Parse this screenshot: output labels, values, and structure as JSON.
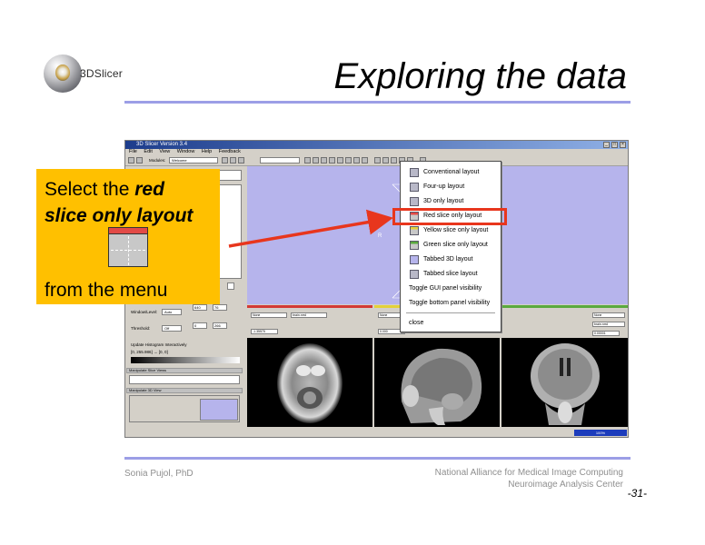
{
  "slide": {
    "title": "Exploring the data",
    "logo_text": "3DSlicer",
    "footer_left": "Sonia Pujol, PhD",
    "footer_right_line1": "National Alliance for Medical Image Computing",
    "footer_right_line2": "Neuroimage Analysis Center",
    "page_number": "-31-"
  },
  "callout": {
    "line1_plain": "Select the ",
    "line1_bold": "red",
    "line2_bold": "slice only layout",
    "footer": "from the menu"
  },
  "app": {
    "window_title": "3D Slicer Version 3.4",
    "menus": [
      "File",
      "Edit",
      "View",
      "Window",
      "Help",
      "Feedback"
    ],
    "toolbar_modules_label": "Modules:",
    "toolbar_module_value": "Welcome",
    "left_panel": {
      "window_level_label": "Window/Level:",
      "window_level_mode": "Auto",
      "window_value": "640",
      "level_value": "76",
      "threshold_label": "Threshold:",
      "threshold_mode": "Off",
      "threshold_min": "0",
      "threshold_max": "266",
      "histogram_checkbox": "Update Histogram Interactively",
      "histogram_range": "[0, 255.986] → [0, 0]",
      "manipulate_slice_views": "Manipulate Slice Views",
      "manipulate_3d_view": "Manipulate 3D View"
    },
    "viewer_label_R": "R",
    "status_progress": "100%",
    "layout_menu": {
      "items": [
        {
          "label": "Conventional layout",
          "icon": "conventional-layout-icon"
        },
        {
          "label": "Four-up layout",
          "icon": "four-up-layout-icon"
        },
        {
          "label": "3D only layout",
          "icon": "3d-only-layout-icon"
        },
        {
          "label": "Red slice only layout",
          "icon": "red-slice-layout-icon"
        },
        {
          "label": "Yellow slice only layout",
          "icon": "yellow-slice-layout-icon"
        },
        {
          "label": "Green slice only layout",
          "icon": "green-slice-layout-icon"
        },
        {
          "label": "Tabbed 3D layout",
          "icon": "tabbed-3d-layout-icon"
        },
        {
          "label": "Tabbed slice layout",
          "icon": "tabbed-slice-layout-icon"
        },
        {
          "label": "Toggle GUI panel visibility",
          "icon": ""
        },
        {
          "label": "Toggle bottom panel visibility",
          "icon": ""
        },
        {
          "label": "close",
          "icon": ""
        }
      ],
      "highlighted": "Red slice only layout"
    },
    "slice_controls": {
      "red": {
        "fg": "None",
        "bg": "brain.nrrd",
        "offset": "-1.35575"
      },
      "yellow": {
        "fg": "None",
        "bg": "brain.nrrd",
        "offset": "0.000"
      },
      "green": {
        "fg": "None",
        "bg": "brain.nrrd",
        "offset": "0.00001"
      }
    }
  },
  "colors": {
    "callout_bg": "#ffc000",
    "highlight": "#e8361d",
    "rule": "#9c9ee6",
    "viewer_bg": "#b6b4ec"
  }
}
